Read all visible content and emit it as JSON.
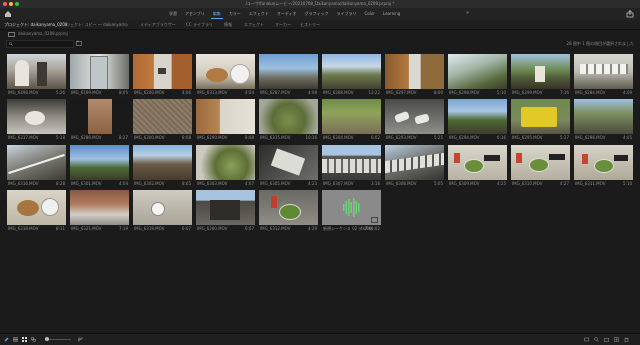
{
  "window": {
    "title": "/ユーザ/tanaka/ムービー/20210708_Daikanyama/daikanyama_0209.prproj *"
  },
  "workspace_tabs": [
    "学習",
    "アセンブリ",
    "編集",
    "カラー",
    "エフェクト",
    "オーディオ",
    "グラフィック",
    "ライブラリ",
    "Color",
    "Learning"
  ],
  "active_workspace": "編集",
  "more_label": "»",
  "panel_tabs": [
    "プロジェクト: daikanyama_0209",
    "プロジェクト: コピー ～ daikanyama",
    "メディアブラウザー",
    "CC ライブラリ",
    "情報",
    "エフェクト",
    "マーカー",
    "ヒストリー"
  ],
  "project_path": "daikanyama_0209.prproj",
  "search": {
    "placeholder": ""
  },
  "selection_info": "28 個中 1 個の項目が選択されました",
  "clips": [
    {
      "name": "IMG_6496.MOV",
      "duration": "5:26"
    },
    {
      "name": "IMG_6199.MOV",
      "duration": "8:05"
    },
    {
      "name": "IMG_6200.MOV",
      "duration": "4:06"
    },
    {
      "name": "IMG_6313.MOV",
      "duration": "4:04"
    },
    {
      "name": "IMG_6287.MOV",
      "duration": "4:08"
    },
    {
      "name": "IMG_6288.MOV",
      "duration": "13:22"
    },
    {
      "name": "IMG_6297.MOV",
      "duration": "8:00"
    },
    {
      "name": "IMG_6298.MOV",
      "duration": "5:10"
    },
    {
      "name": "IMG_6299.MOV",
      "duration": "7:16"
    },
    {
      "name": "IMG_6284.MOV",
      "duration": "4:09"
    },
    {
      "name": "IMG_6317.MOV",
      "duration": "5:18"
    },
    {
      "name": "IMG_6289.MOV",
      "duration": "8:27"
    },
    {
      "name": "IMG_6300.MOV",
      "duration": "8:08"
    },
    {
      "name": "IMG_6290.MOV",
      "duration": "8:08"
    },
    {
      "name": "IMG_6315.MOV",
      "duration": "10:16"
    },
    {
      "name": "IMG_6304.MOV",
      "duration": "6:02"
    },
    {
      "name": "IMG_6293.MOV",
      "duration": "5:25"
    },
    {
      "name": "IMG_6294.MOV",
      "duration": "6:16"
    },
    {
      "name": "IMG_6295.MOV",
      "duration": "5:27"
    },
    {
      "name": "IMG_6296.MOV",
      "duration": "4:05"
    },
    {
      "name": "IMG_6316.MOV",
      "duration": "8:28"
    },
    {
      "name": "IMG_6301.MOV",
      "duration": "4:04"
    },
    {
      "name": "IMG_6302.MOV",
      "duration": "8:05"
    },
    {
      "name": "IMG_6303.MOV",
      "duration": "4:07"
    },
    {
      "name": "IMG_6305.MOV",
      "duration": "4:23"
    },
    {
      "name": "IMG_6307.MOV",
      "duration": "3:16"
    },
    {
      "name": "IMG_6308.MOV",
      "duration": "5:05"
    },
    {
      "name": "IMG_6309.MOV",
      "duration": "4:25"
    },
    {
      "name": "IMG_6310.MOV",
      "duration": "4:27"
    },
    {
      "name": "IMG_6311.MOV",
      "duration": "5:10"
    },
    {
      "name": "IMG_6318.MOV",
      "duration": "8:11"
    },
    {
      "name": "IMG_6321.MOV",
      "duration": "7:19"
    },
    {
      "name": "IMG_6319.MOV",
      "duration": "6:07"
    },
    {
      "name": "IMG_6280.MOV",
      "duration": "6:07"
    },
    {
      "name": "IMG_6312.MOV",
      "duration": "4:29"
    },
    {
      "name": "新規シーケンス 02 (4k/8k)",
      "duration": "7:46:02"
    }
  ],
  "colors": {
    "accent": "#5aa6ff",
    "sequence_wave": "#6fd27a"
  }
}
